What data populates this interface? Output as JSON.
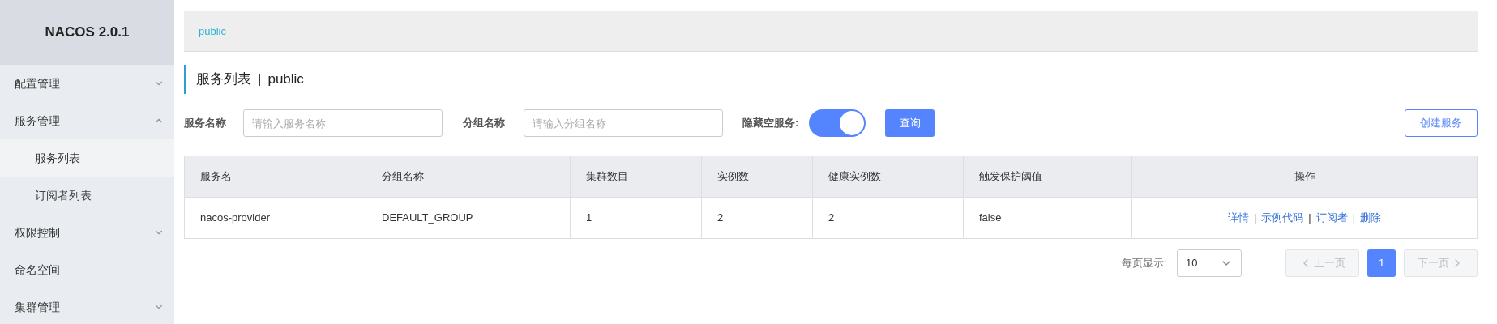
{
  "sidebar": {
    "title": "NACOS 2.0.1",
    "items": [
      {
        "label": "配置管理",
        "expanded": false
      },
      {
        "label": "服务管理",
        "expanded": true,
        "children": [
          {
            "label": "服务列表",
            "selected": true
          },
          {
            "label": "订阅者列表",
            "selected": false
          }
        ]
      },
      {
        "label": "权限控制",
        "expanded": false
      },
      {
        "label": "命名空间"
      },
      {
        "label": "集群管理",
        "expanded": false
      }
    ]
  },
  "breadcrumb": "public",
  "page_title": {
    "title": "服务列表",
    "separator": "|",
    "namespace": "public"
  },
  "filters": {
    "service_name": {
      "label": "服务名称",
      "placeholder": "请输入服务名称"
    },
    "group_name": {
      "label": "分组名称",
      "placeholder": "请输入分组名称"
    },
    "hide_empty": {
      "label": "隐藏空服务:",
      "on": true
    },
    "query_button": "查询",
    "create_button": "创建服务"
  },
  "table": {
    "columns": [
      "服务名",
      "分组名称",
      "集群数目",
      "实例数",
      "健康实例数",
      "触发保护阈值",
      "操作"
    ],
    "rows": [
      {
        "cells": [
          "nacos-provider",
          "DEFAULT_GROUP",
          "1",
          "2",
          "2",
          "false"
        ],
        "actions": [
          {
            "kind": "link",
            "text": "详情"
          },
          {
            "kind": "separator",
            "text": "|"
          },
          {
            "kind": "link",
            "text": "示例代码"
          },
          {
            "kind": "separator",
            "text": "|"
          },
          {
            "kind": "link",
            "text": "订阅者"
          },
          {
            "kind": "separator",
            "text": "|"
          },
          {
            "kind": "link",
            "text": "删除"
          }
        ]
      }
    ]
  },
  "pagination": {
    "page_size_label": "每页显示:",
    "page_size": "10",
    "prev": "上一页",
    "next": "下一页",
    "pages": [
      {
        "label": "1",
        "selected": true
      }
    ]
  }
}
